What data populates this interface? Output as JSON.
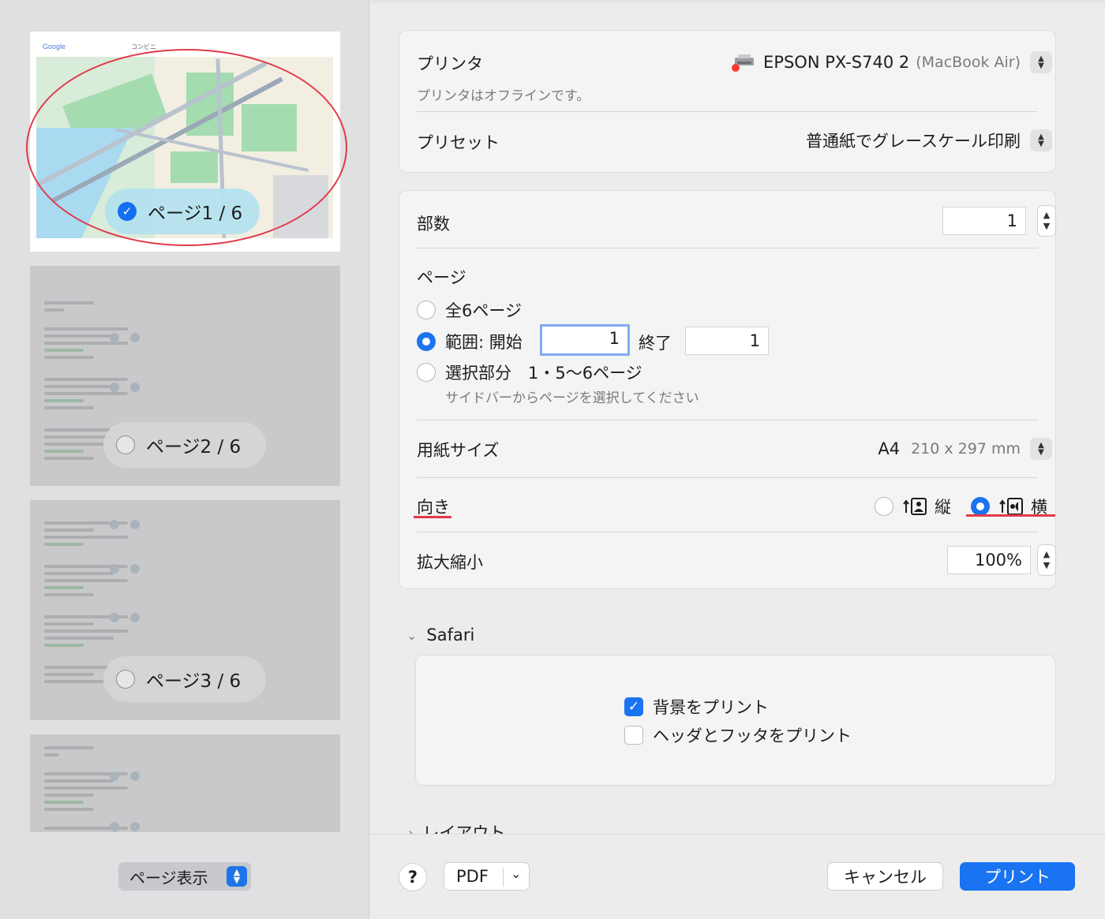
{
  "sidebar": {
    "map_google_label": "Google",
    "map_title": "コンビニ",
    "pages": [
      {
        "label": "ページ1 / 6",
        "selected": true
      },
      {
        "label": "ページ2 / 6",
        "selected": false
      },
      {
        "label": "ページ3 / 6",
        "selected": false
      }
    ],
    "view_select": "ページ表示"
  },
  "printer": {
    "label": "プリンタ",
    "name": "EPSON PX-S740 2",
    "host": "(MacBook Air)",
    "status": "プリンタはオフラインです。",
    "preset_label": "プリセット",
    "preset_value": "普通紙でグレースケール印刷"
  },
  "copies": {
    "label": "部数",
    "value": "1"
  },
  "pages": {
    "label": "ページ",
    "all": "全6ページ",
    "range": "範囲: 開始",
    "range_from": "1",
    "range_to_label": "終了",
    "range_to": "1",
    "selection": "選択部分　1・5〜6ページ",
    "selection_hint": "サイドバーからページを選択してください",
    "selected_option": "range"
  },
  "paper": {
    "label": "用紙サイズ",
    "size": "A4",
    "dims": "210 x 297 mm"
  },
  "orientation": {
    "label": "向き",
    "portrait": "縦",
    "landscape": "横",
    "selected": "landscape"
  },
  "scale": {
    "label": "拡大縮小",
    "value": "100%"
  },
  "safari": {
    "label": "Safari",
    "print_background": "背景をプリント",
    "print_background_checked": true,
    "header_footer": "ヘッダとフッタをプリント",
    "header_footer_checked": false
  },
  "layout_section": "レイアウト",
  "footer": {
    "help": "?",
    "pdf": "PDF",
    "cancel": "キャンセル",
    "print": "プリント"
  },
  "colors": {
    "accent": "#1a73f0",
    "annotation_red": "#e13a4b"
  }
}
